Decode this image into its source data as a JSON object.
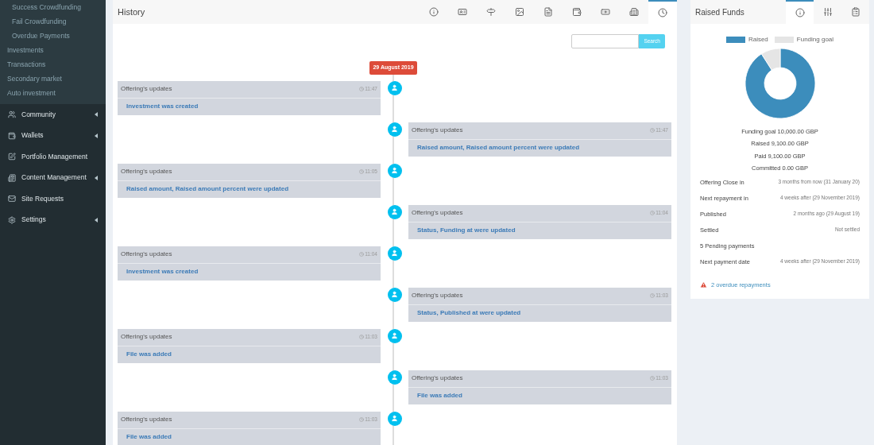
{
  "sidebar": {
    "nested_sub_items": [
      "Success Crowdfunding",
      "Fail Crowdfunding",
      "Overdue Payments"
    ],
    "sub_items": [
      "Investments",
      "Transactions",
      "Secondary market",
      "Auto investment"
    ],
    "items": [
      {
        "label": "Community",
        "expandable": true
      },
      {
        "label": "Wallets",
        "expandable": true
      },
      {
        "label": "Portfolio Management",
        "expandable": false
      },
      {
        "label": "Content Management",
        "expandable": true
      },
      {
        "label": "Site Requests",
        "expandable": false
      },
      {
        "label": "Settings",
        "expandable": true
      }
    ]
  },
  "history": {
    "title": "History",
    "tabs": [
      {
        "selected": false
      },
      {
        "selected": false
      },
      {
        "selected": false
      },
      {
        "selected": false
      },
      {
        "selected": false
      },
      {
        "selected": false
      },
      {
        "selected": false
      },
      {
        "selected": false
      },
      {
        "selected": true
      }
    ],
    "search": {
      "button": "Search"
    },
    "date": "29 August 2019",
    "entries": [
      {
        "title": "Offering's updates",
        "time": "11:47",
        "text": "Investment was created"
      },
      {
        "title": "Offering's updates",
        "time": "11:47",
        "text": "Raised amount, Raised amount percent were updated"
      },
      {
        "title": "Offering's updates",
        "time": "11:05",
        "text": "Raised amount, Raised amount percent were updated"
      },
      {
        "title": "Offering's updates",
        "time": "11:04",
        "text": "Status, Funding at were updated"
      },
      {
        "title": "Offering's updates",
        "time": "11:04",
        "text": "Investment was created"
      },
      {
        "title": "Offering's updates",
        "time": "11:03",
        "text": "Status, Published at were updated"
      },
      {
        "title": "Offering's updates",
        "time": "11:03",
        "text": "File was added"
      },
      {
        "title": "Offering's updates",
        "time": "11:03",
        "text": "File was added"
      },
      {
        "title": "Offering's updates",
        "time": "11:03",
        "text": "File was added"
      }
    ]
  },
  "raised_funds": {
    "title": "Raised Funds",
    "tabs": [
      {
        "selected": true
      },
      {
        "selected": false
      },
      {
        "selected": false
      }
    ],
    "chart_data": {
      "type": "donut",
      "categories": [
        "Raised",
        "Funding goal"
      ],
      "values": [
        91,
        9
      ],
      "legend": "top",
      "colors": [
        "#3c8dbc",
        "#e5e5e5"
      ]
    },
    "summary": [
      "Funding goal 10,000.00 GBP",
      "Raised 9,100.00 GBP",
      "Paid 9,100.00 GBP",
      "Committed 0.00 GBP"
    ],
    "details": [
      {
        "label": "Offering Close in",
        "value": "3 months from now (31 January 20)"
      },
      {
        "label": "Next repayment in",
        "value": "4 weeks after (29 November 2019)"
      },
      {
        "label": "Published",
        "value": "2 months ago (29 August 19)"
      },
      {
        "label": "Settled",
        "value": "Not settled"
      },
      {
        "label": "5 Pending payments"
      },
      {
        "label": "Next payment date",
        "value": "4 weeks after (29 November 2019)"
      }
    ],
    "alert": "2 overdue repayments"
  }
}
